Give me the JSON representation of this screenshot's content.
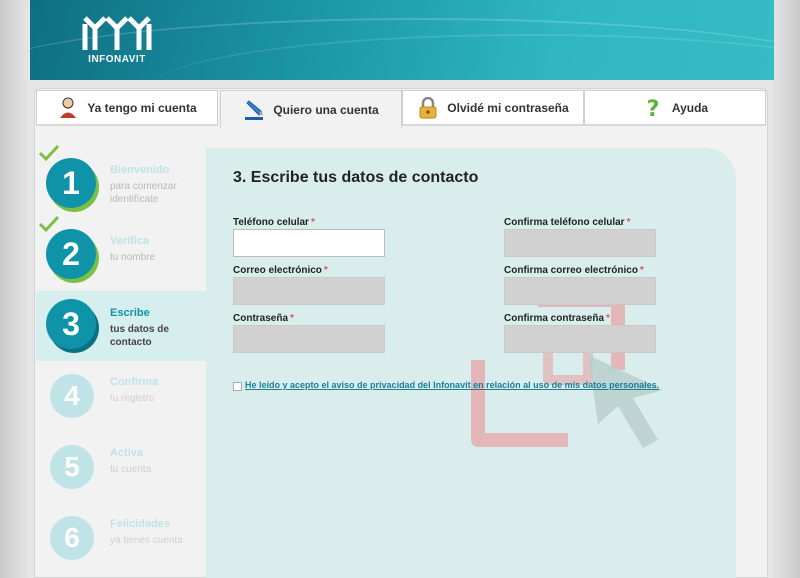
{
  "brand": {
    "name": "INFONAVIT"
  },
  "tabs": [
    {
      "label": "Ya tengo mi cuenta",
      "icon": "user-icon"
    },
    {
      "label": "Quiero una cuenta",
      "icon": "pencil-icon"
    },
    {
      "label": "Olvidé mi contraseña",
      "icon": "lock-icon"
    },
    {
      "label": "Ayuda",
      "icon": "question-icon"
    }
  ],
  "steps": [
    {
      "number": "1",
      "title": "Bienvenido",
      "subtitle": "para comenzar identifícate",
      "state": "done"
    },
    {
      "number": "2",
      "title": "Verifica",
      "subtitle": "tu nombre",
      "state": "done"
    },
    {
      "number": "3",
      "title": "Escribe",
      "subtitle": "tus datos de contacto",
      "state": "current"
    },
    {
      "number": "4",
      "title": "Confirma",
      "subtitle": "tu registro",
      "state": "todo"
    },
    {
      "number": "5",
      "title": "Activa",
      "subtitle": "tu cuenta",
      "state": "todo"
    },
    {
      "number": "6",
      "title": "Felicidades",
      "subtitle": "ya tienes cuenta",
      "state": "todo"
    }
  ],
  "form": {
    "title": "3. Escribe tus datos de contacto",
    "required_mark": "*",
    "fields": {
      "phone": {
        "label": "Teléfono celular",
        "value": ""
      },
      "phone_confirm": {
        "label": "Confirma teléfono celular",
        "value": ""
      },
      "email": {
        "label": "Correo electrónico",
        "value": ""
      },
      "email_confirm": {
        "label": "Confirma correo electrónico",
        "value": ""
      },
      "password": {
        "label": "Contraseña",
        "value": ""
      },
      "password_confirm": {
        "label": "Confirma contraseña",
        "value": ""
      }
    },
    "privacy_text": "He leído y acepto el aviso de privacidad del Infonavit en relación al uso de mis datos personales."
  },
  "colors": {
    "accent": "#0e93a8",
    "check_green": "#7ac143",
    "required_red": "#e05656",
    "form_bg": "#d9eeec"
  }
}
